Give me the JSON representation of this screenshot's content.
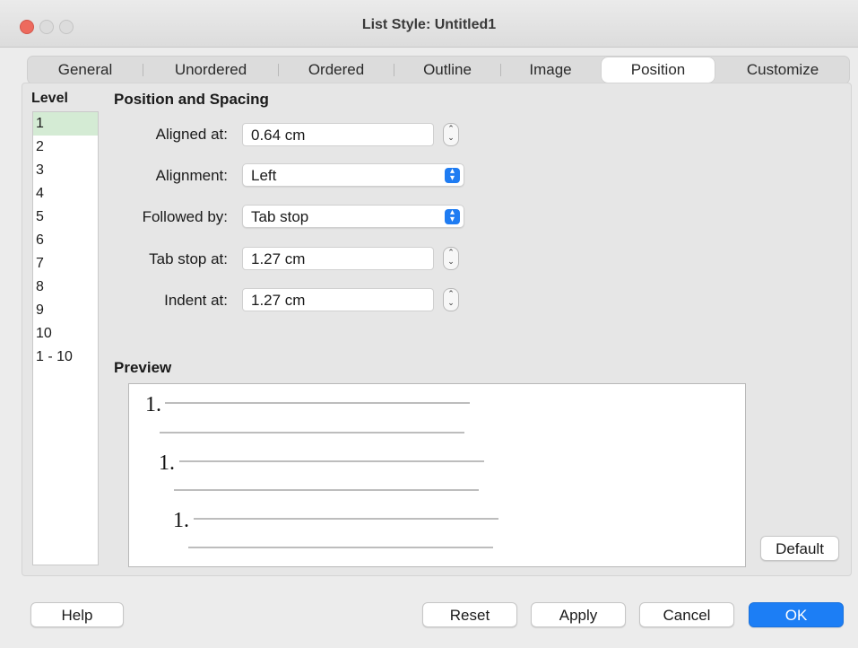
{
  "window": {
    "title": "List Style: Untitled1"
  },
  "tabs": [
    {
      "label": "General"
    },
    {
      "label": "Unordered"
    },
    {
      "label": "Ordered"
    },
    {
      "label": "Outline"
    },
    {
      "label": "Image"
    },
    {
      "label": "Position"
    },
    {
      "label": "Customize"
    }
  ],
  "selected_tab": "Position",
  "level": {
    "heading": "Level",
    "items": [
      "1",
      "2",
      "3",
      "4",
      "5",
      "6",
      "7",
      "8",
      "9",
      "10",
      "1 - 10"
    ],
    "selected": "1"
  },
  "position": {
    "heading": "Position and Spacing",
    "aligned_at": {
      "label": "Aligned at:",
      "value": "0.64 cm"
    },
    "alignment": {
      "label": "Alignment:",
      "value": "Left"
    },
    "followed_by": {
      "label": "Followed by:",
      "value": "Tab stop"
    },
    "tab_stop_at": {
      "label": "Tab stop at:",
      "value": "1.27 cm"
    },
    "indent_at": {
      "label": "Indent at:",
      "value": "1.27 cm"
    }
  },
  "preview": {
    "heading": "Preview",
    "numbers": [
      "1.",
      "1.",
      "1."
    ]
  },
  "buttons": {
    "default": "Default",
    "help": "Help",
    "reset": "Reset",
    "apply": "Apply",
    "cancel": "Cancel",
    "ok": "OK"
  },
  "colors": {
    "accent": "#1c7ef5",
    "selected_level": "#d4ebd4",
    "close_button": "#ed6a5e"
  }
}
